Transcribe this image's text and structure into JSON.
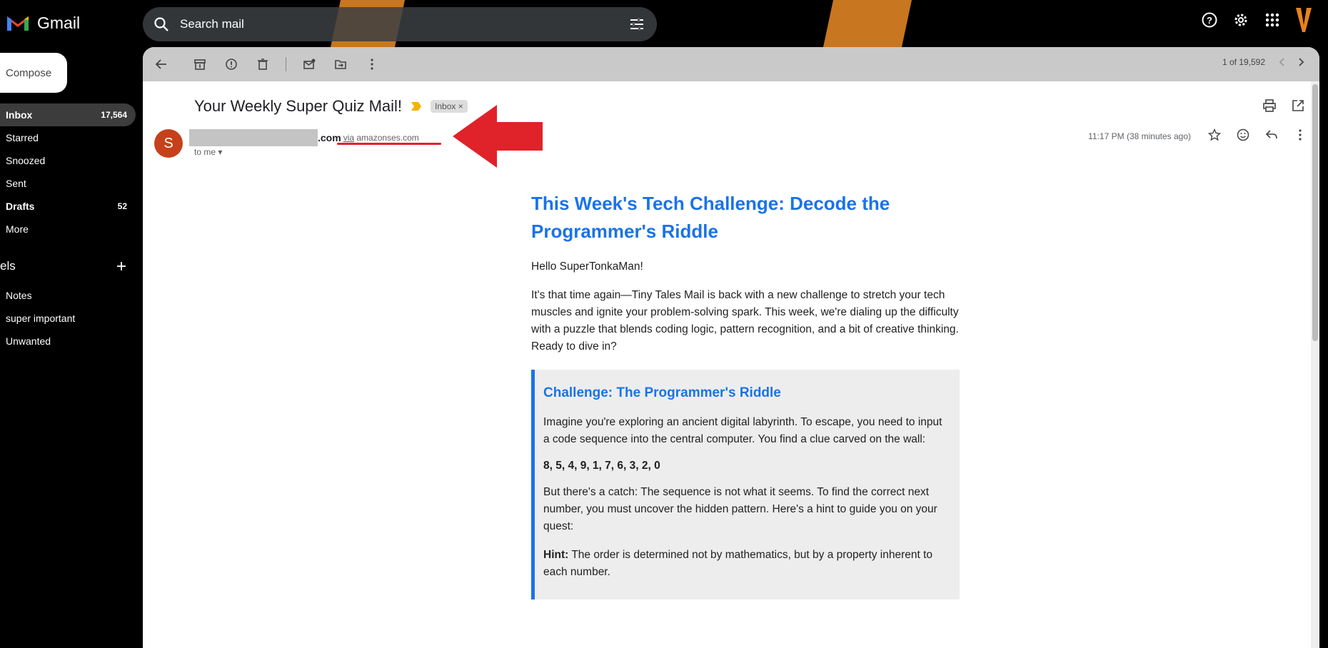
{
  "app": {
    "name": "Gmail"
  },
  "search": {
    "placeholder": "Search mail"
  },
  "sidebar": {
    "compose_label": "Compose",
    "items": [
      {
        "label": "Inbox",
        "count": "17,564"
      },
      {
        "label": "Starred",
        "count": ""
      },
      {
        "label": "Snoozed",
        "count": ""
      },
      {
        "label": "Sent",
        "count": ""
      },
      {
        "label": "Drafts",
        "count": "52"
      },
      {
        "label": "More",
        "count": ""
      }
    ],
    "labels_heading": "els",
    "labels": [
      "Notes",
      "super important",
      "Unwanted"
    ]
  },
  "toolbar": {
    "pager_text": "1 of 19,592"
  },
  "email": {
    "subject": "Your Weekly Super Quiz Mail!",
    "label_chip": "Inbox",
    "sender_initial": "S",
    "sender_domain_suffix": ".com",
    "via_word": "via",
    "via_domain": "amazonses.com",
    "to_line": "to me",
    "time": "11:17 PM (38 minutes ago)"
  },
  "body": {
    "heading": "This Week's Tech Challenge: Decode the Programmer's Riddle",
    "greeting": "Hello SuperTonkaMan!",
    "intro": "It's that time again—Tiny Tales Mail is back with a new challenge to stretch your tech muscles and ignite your problem-solving spark. This week, we're dialing up the difficulty with a puzzle that blends coding logic, pattern recognition, and a bit of creative thinking. Ready to dive in?",
    "challenge_title": "Challenge: The Programmer's Riddle",
    "challenge_p1": "Imagine you're exploring an ancient digital labyrinth. To escape, you need to input a code sequence into the central computer. You find a clue carved on the wall:",
    "sequence": "8, 5, 4, 9, 1, 7, 6, 3, 2, 0",
    "challenge_p2": "But there's a catch: The sequence is not what it seems. To find the correct next number, you must uncover the hidden pattern. Here's a hint to guide you on your quest:",
    "hint_label": "Hint:",
    "hint_text": " The order is determined not by mathematics, but by a property inherent to each number."
  },
  "colors": {
    "accent": "#1a73e8",
    "arrow": "#e0222a",
    "sender_avatar": "#c5411a",
    "wallpaper_orange": "#c8761f"
  }
}
